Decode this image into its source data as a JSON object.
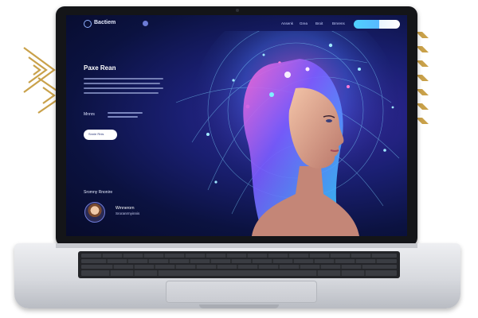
{
  "site": {
    "logo_text": "Bactiem",
    "nav_brand_text": "",
    "nav_links": [
      "",
      "Ansenk",
      "Grea",
      "Broit",
      "Brnrens"
    ],
    "cta_primary": "",
    "cta_secondary": ""
  },
  "hero": {
    "title": "Paxe Rean",
    "section_label": "Mnnrs",
    "button_label": "Snnie Rnis"
  },
  "author": {
    "heading": "Sromny Rnonire",
    "name": "Wrnnerorn",
    "subtitle": "Sroranrmyinnis"
  },
  "colors": {
    "screen_bg": "#0b1240",
    "accent": "#4fd0ff",
    "deco": "#c9a14a"
  }
}
